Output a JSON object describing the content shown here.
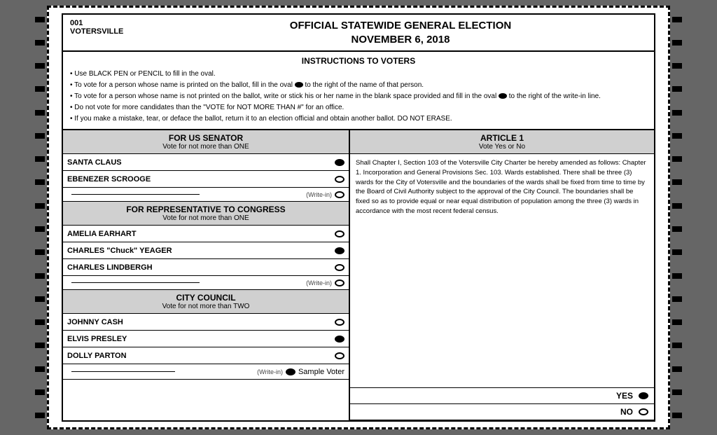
{
  "page": {
    "background": "#555"
  },
  "header": {
    "precinct_number": "001",
    "precinct_name": "VOTERSVILLE",
    "election_title": "OFFICIAL STATEWIDE GENERAL ELECTION",
    "election_date": "NOVEMBER 6, 2018"
  },
  "instructions": {
    "title": "INSTRUCTIONS TO VOTERS",
    "lines": [
      "Use BLACK PEN or PENCIL to fill in the oval.",
      "To vote for a person whose name is printed on the ballot, fill in the oval  to the right of the name of that person.",
      "To vote for a person whose name is not printed on the ballot, write or stick his or her name in the blank space provided and fill in the oval  to the right of the write-in line.",
      "Do not vote for more candidates than the \"VOTE for NOT MORE THAN #\" for an office.",
      "If you make a mistake, tear, or deface the ballot, return it to an election official and obtain another ballot. DO NOT ERASE."
    ]
  },
  "races": [
    {
      "id": "senator",
      "title": "FOR US SENATOR",
      "subtitle": "Vote for not more than ONE",
      "candidates": [
        {
          "name": "SANTA CLAUS",
          "filled": true
        },
        {
          "name": "EBENEZER SCROOGE",
          "filled": false
        }
      ],
      "write_in_label": "(Write-in)"
    },
    {
      "id": "congress",
      "title": "FOR REPRESENTATIVE TO CONGRESS",
      "subtitle": "Vote for not more than ONE",
      "candidates": [
        {
          "name": "AMELIA EARHART",
          "filled": false
        },
        {
          "name": "CHARLES \"Chuck\" YEAGER",
          "filled": true
        },
        {
          "name": "CHARLES LINDBERGH",
          "filled": false
        }
      ],
      "write_in_label": "(Write-in)"
    },
    {
      "id": "city-council",
      "title": "CITY COUNCIL",
      "subtitle": "Vote for not more than TWO",
      "candidates": [
        {
          "name": "JOHNNY CASH",
          "filled": false
        },
        {
          "name": "ELVIS PRESLEY",
          "filled": true
        },
        {
          "name": "DOLLY PARTON",
          "filled": false
        }
      ],
      "write_in_label": "(Write-in)"
    }
  ],
  "article": {
    "title": "ARTICLE 1",
    "subtitle": "Vote Yes or No",
    "text": "Shall Chapter I, Section 103 of the Votersville City Charter be hereby amended as follows: Chapter 1. Incorporation and General Provisions Sec. 103. Wards established. There shall be three (3) wards for the City of Votersville and the boundaries of the wards shall be fixed from time to time by the Board of Civil Authority subject to the approval of the City Council. The boundaries shall be fixed so as to provide equal or near equal distribution of population among the three (3) wards in accordance with the most recent federal census.",
    "yes_label": "YES",
    "yes_filled": true,
    "no_label": "NO",
    "no_filled": false
  },
  "footer": {
    "write_in_label": "(Write-in)",
    "sample_voter": "Sample Voter"
  },
  "timing_marks_count": 18
}
